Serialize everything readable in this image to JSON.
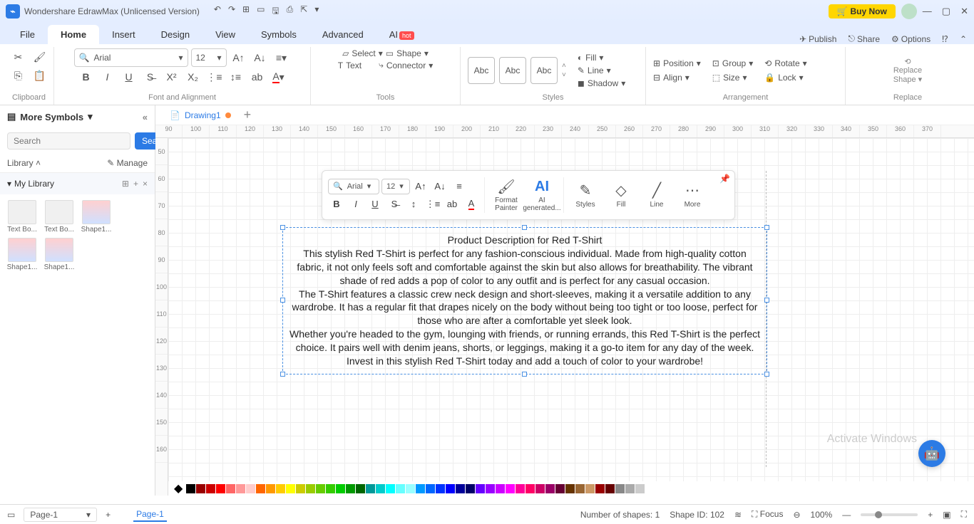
{
  "titlebar": {
    "app_title": "Wondershare EdrawMax (Unlicensed Version)",
    "buy_label": "Buy Now"
  },
  "menu": {
    "tabs": [
      "File",
      "Home",
      "Insert",
      "Design",
      "View",
      "Symbols",
      "Advanced",
      "AI"
    ],
    "active": "Home",
    "publish": "Publish",
    "share": "Share",
    "options": "Options"
  },
  "ribbon": {
    "clipboard": "Clipboard",
    "font_align": "Font and Alignment",
    "tools": "Tools",
    "styles": "Styles",
    "arrangement": "Arrangement",
    "replace": "Replace",
    "font_name": "Arial",
    "font_size": "12",
    "select": "Select",
    "shape": "Shape",
    "text": "Text",
    "connector": "Connector",
    "abc": "Abc",
    "fill": "Fill",
    "line": "Line",
    "shadow": "Shadow",
    "position": "Position",
    "align": "Align",
    "group": "Group",
    "size": "Size",
    "rotate": "Rotate",
    "lock": "Lock",
    "replace_shape": "Replace\nShape"
  },
  "sidebar": {
    "title": "More Symbols",
    "search_placeholder": "Search",
    "search_btn": "Search",
    "library": "Library",
    "manage": "Manage",
    "my_library": "My Library",
    "items": [
      {
        "label": "Text Bo..."
      },
      {
        "label": "Text Bo..."
      },
      {
        "label": "Shape1..."
      },
      {
        "label": "Shape1..."
      },
      {
        "label": "Shape1..."
      }
    ]
  },
  "doc": {
    "tab_name": "Drawing1",
    "ruler_h": [
      "90",
      "100",
      "110",
      "120",
      "130",
      "140",
      "150",
      "160",
      "170",
      "180",
      "190",
      "200",
      "210",
      "220",
      "230",
      "240",
      "250",
      "260",
      "270",
      "280",
      "290",
      "300",
      "310",
      "320",
      "330",
      "340",
      "350",
      "360",
      "370"
    ],
    "ruler_v": [
      "50",
      "60",
      "70",
      "80",
      "90",
      "100",
      "110",
      "120",
      "130",
      "140",
      "150",
      "160"
    ],
    "text_title": "Product Description for Red T-Shirt",
    "text_p1": "This stylish Red T-Shirt is perfect for any fashion-conscious individual. Made from high-quality cotton fabric, it not only feels soft and comfortable against the skin but also allows for breathability. The vibrant shade of red adds a pop of color to any outfit and is perfect for any casual occasion.",
    "text_p2": "The T-Shirt features a classic crew neck design and short-sleeves, making it a versatile addition to any wardrobe. It has a regular fit that drapes nicely on the body without being too tight or too loose, perfect for those who are after a comfortable yet sleek look.",
    "text_p3": "Whether you're headed to the gym, lounging with friends, or running errands, this Red T-Shirt is the perfect choice. It pairs well with denim jeans, shorts, or leggings, making it a go-to item for any day of the week.",
    "text_p4": "Invest in this stylish Red T-Shirt today and add a touch of color to your wardrobe!"
  },
  "float": {
    "font": "Arial",
    "size": "12",
    "format_painter": "Format\nPainter",
    "ai_gen": "AI\ngenerated...",
    "styles": "Styles",
    "fill": "Fill",
    "line": "Line",
    "more": "More"
  },
  "status": {
    "page_sel": "Page-1",
    "page_tab": "Page-1",
    "shapes": "Number of shapes: 1",
    "shape_id": "Shape ID: 102",
    "focus": "Focus",
    "zoom": "100%"
  },
  "watermark": "Activate Windows",
  "colors": [
    "#000",
    "#900",
    "#c00",
    "#f00",
    "#f66",
    "#f99",
    "#fcc",
    "#f60",
    "#f90",
    "#fc0",
    "#ff0",
    "#cc0",
    "#9c0",
    "#6c0",
    "#3c0",
    "#0c0",
    "#090",
    "#060",
    "#099",
    "#0cc",
    "#0ff",
    "#6ff",
    "#9ff",
    "#09f",
    "#06f",
    "#03f",
    "#00f",
    "#009",
    "#006",
    "#60f",
    "#90f",
    "#c0f",
    "#f0f",
    "#f09",
    "#f06",
    "#c06",
    "#906",
    "#603",
    "#630",
    "#963",
    "#c96",
    "#900",
    "#600",
    "#888",
    "#aaa",
    "#ccc"
  ]
}
